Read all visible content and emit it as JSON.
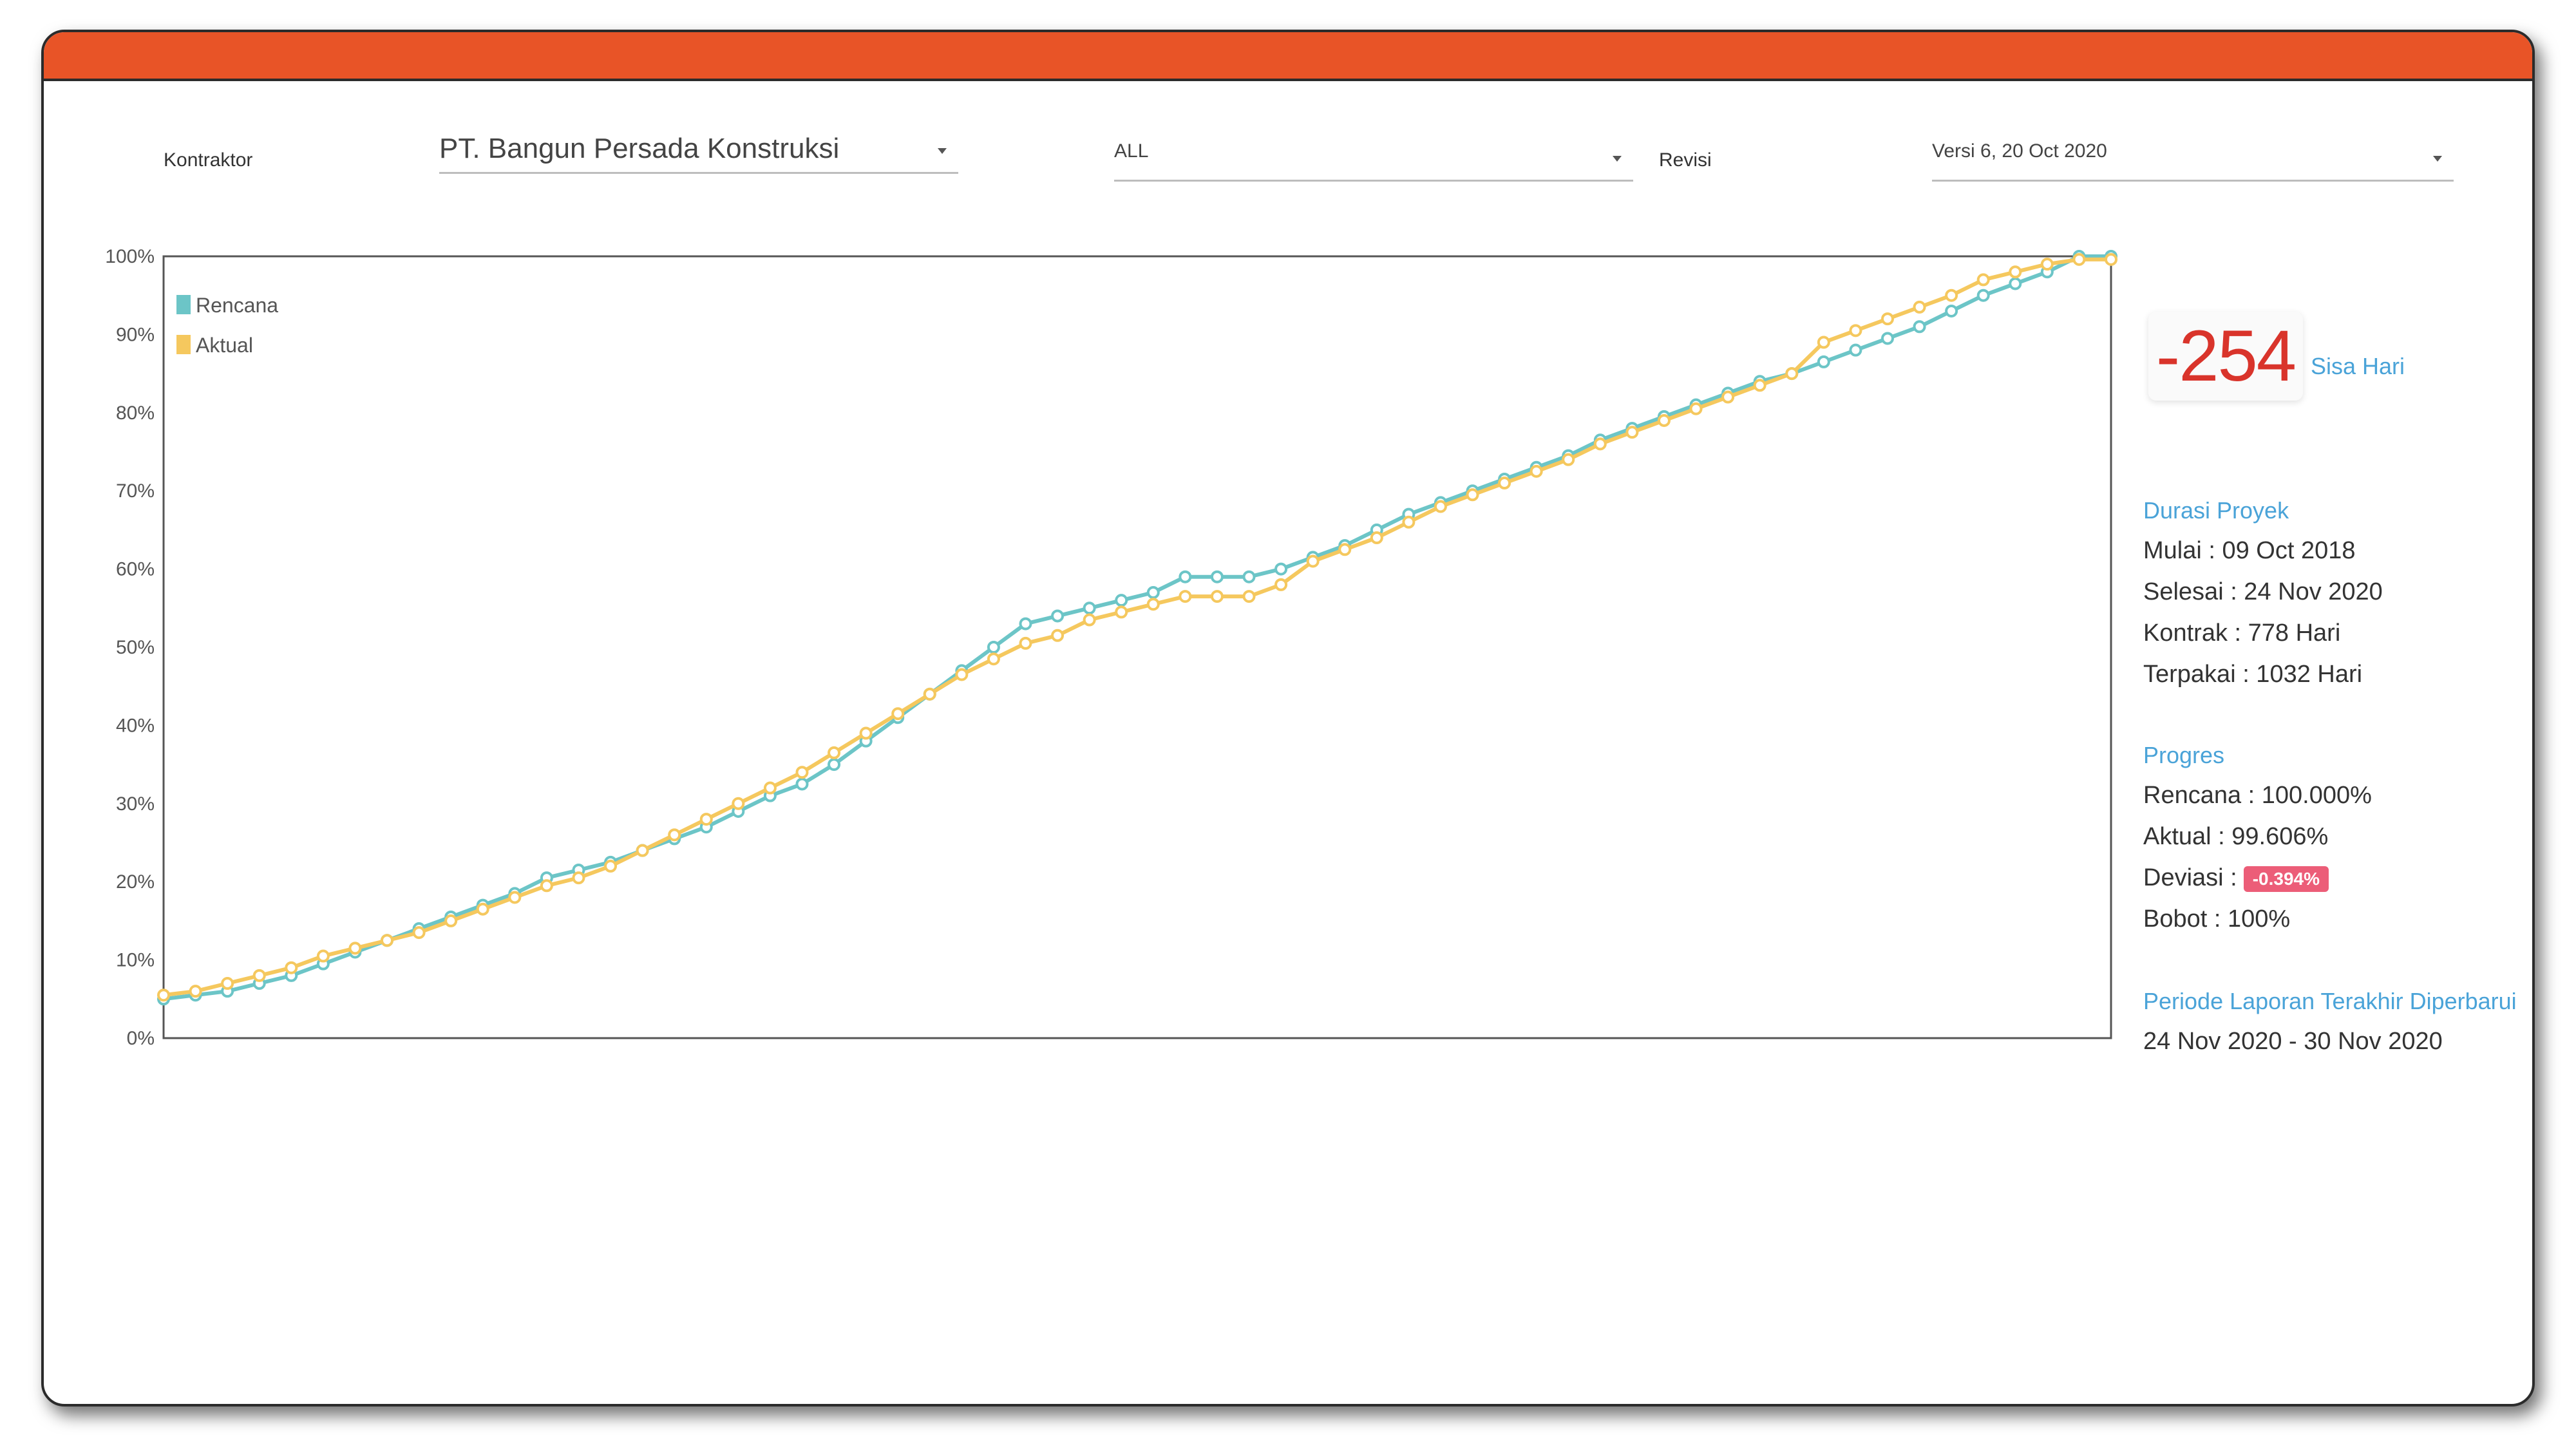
{
  "filters": {
    "kontraktor_label": "Kontraktor",
    "kontraktor_value": "PT. Bangun Persada Konstruksi",
    "scope_value": "ALL",
    "revisi_label": "Revisi",
    "revisi_value": "Versi 6, 20 Oct 2020"
  },
  "summary": {
    "sisa_hari_value": "-254",
    "sisa_hari_label": "Sisa Hari",
    "durasi_head": "Durasi Proyek",
    "mulai": "Mulai : 09 Oct 2018",
    "selesai": "Selesai : 24 Nov 2020",
    "kontrak": "Kontrak : 778 Hari",
    "terpakai": "Terpakai : 1032 Hari",
    "progres_head": "Progres",
    "rencana": "Rencana : 100.000%",
    "aktual": "Aktual : 99.606%",
    "deviasi_label": "Deviasi :",
    "deviasi_value": "-0.394%",
    "bobot": "Bobot : 100%",
    "periode_head": "Periode Laporan Terakhir Diperbarui",
    "periode_value": "24 Nov 2020 - 30 Nov 2020"
  },
  "colors": {
    "accent": "#e85427",
    "rencana": "#6cc5c7",
    "aktual": "#f5c85e",
    "link": "#4aa3d8",
    "negative": "#d9342b",
    "badge": "#ec5d78"
  },
  "chart_data": {
    "type": "line",
    "ylim": [
      0,
      100
    ],
    "yticks": [
      "0%",
      "10%",
      "20%",
      "30%",
      "40%",
      "50%",
      "60%",
      "70%",
      "80%",
      "90%",
      "100%"
    ],
    "legend_position": "top-left",
    "grid": false,
    "x": [
      1,
      2,
      3,
      4,
      5,
      6,
      7,
      8,
      9,
      10,
      11,
      12,
      13,
      14,
      15,
      16,
      17,
      18,
      19,
      20,
      21,
      22,
      23,
      24,
      25,
      26,
      27,
      28,
      29,
      30,
      31,
      32,
      33,
      34,
      35,
      36,
      37,
      38,
      39,
      40,
      41,
      42,
      43,
      44,
      45,
      46,
      47,
      48,
      49,
      50,
      51,
      52,
      53,
      54,
      55,
      56,
      57,
      58,
      59,
      60,
      61,
      62
    ],
    "series": [
      {
        "name": "Rencana",
        "values": [
          5,
          5.5,
          6,
          7,
          8,
          9.5,
          11,
          12.5,
          14,
          15.5,
          17,
          18.5,
          20.5,
          21.5,
          22.5,
          24,
          25.5,
          27,
          29,
          31,
          32.5,
          35,
          38,
          41,
          44,
          47,
          50,
          53,
          54,
          55,
          56,
          57,
          59,
          59,
          59,
          60,
          61.5,
          63,
          65,
          67,
          68.5,
          70,
          71.5,
          73,
          74.5,
          76.5,
          78,
          79.5,
          81,
          82.5,
          84,
          85,
          86.5,
          88,
          89.5,
          91,
          93,
          95,
          96.5,
          98,
          100,
          100
        ]
      },
      {
        "name": "Aktual",
        "values": [
          5.5,
          6,
          7,
          8,
          9,
          10.5,
          11.5,
          12.5,
          13.5,
          15,
          16.5,
          18,
          19.5,
          20.5,
          22,
          24,
          26,
          28,
          30,
          32,
          34,
          36.5,
          39,
          41.5,
          44,
          46.5,
          48.5,
          50.5,
          51.5,
          53.5,
          54.5,
          55.5,
          56.5,
          56.5,
          56.5,
          58,
          61,
          62.5,
          64,
          66,
          68,
          69.5,
          71,
          72.5,
          74,
          76,
          77.5,
          79,
          80.5,
          82,
          83.5,
          85,
          89,
          90.5,
          92,
          93.5,
          95,
          97,
          98,
          99,
          99.6,
          99.6
        ]
      }
    ]
  }
}
